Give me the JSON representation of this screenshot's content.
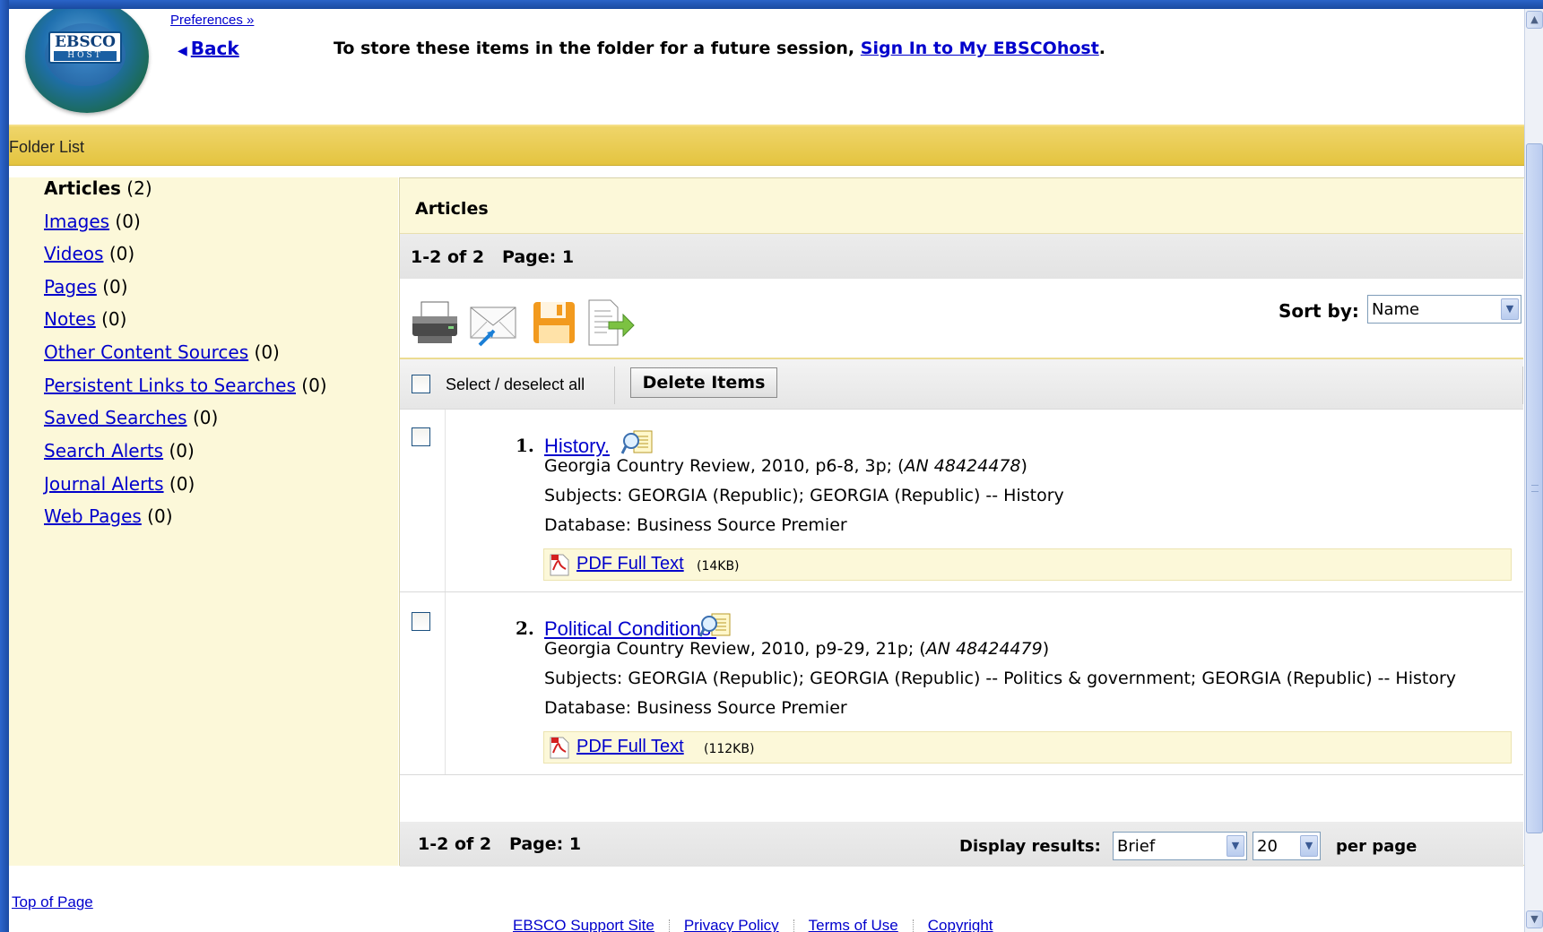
{
  "header": {
    "logo_text_top": "EBSCO",
    "logo_text_bottom": "HOST",
    "preferences_link": "Preferences »",
    "back_link": "Back",
    "signin_message_prefix": "To store these items in the folder for a future session,",
    "signin_link": "Sign In to My EBSCOhost",
    "signin_message_suffix": "."
  },
  "folder_bar": {
    "title": "Folder List"
  },
  "sidebar": {
    "items": [
      {
        "label": "Articles",
        "count": "(2)",
        "active": true
      },
      {
        "label": "Images",
        "count": "(0)"
      },
      {
        "label": "Videos",
        "count": "(0)"
      },
      {
        "label": "Pages",
        "count": "(0)"
      },
      {
        "label": "Notes",
        "count": "(0)"
      },
      {
        "label": "Other Content Sources",
        "count": "(0)"
      },
      {
        "label": "Persistent Links to Searches",
        "count": "(0)"
      },
      {
        "label": "Saved Searches",
        "count": "(0)"
      },
      {
        "label": "Search Alerts",
        "count": "(0)"
      },
      {
        "label": "Journal Alerts",
        "count": "(0)"
      },
      {
        "label": "Web Pages",
        "count": "(0)"
      }
    ]
  },
  "main": {
    "title": "Articles",
    "pager_text": "1-2 of 2   Page: 1",
    "toolbar": {
      "icons": [
        "print-icon",
        "email-icon",
        "save-icon",
        "export-icon"
      ],
      "sort_label": "Sort by:",
      "sort_value": "Name"
    },
    "select_all_label": "Select / deselect all",
    "delete_button": "Delete Items",
    "results": [
      {
        "number": "1.",
        "title": "History.",
        "source_prefix": "Georgia Country Review, 2010, p6-8, 3p; (",
        "accession": "AN 48424478",
        "source_suffix": ")",
        "subjects": "Subjects: GEORGIA (Republic); GEORGIA (Republic) -- History",
        "database": "Database: Business Source Premier",
        "pdf_link": "PDF Full Text",
        "pdf_size": "(14KB)"
      },
      {
        "number": "2.",
        "title": "Political Conditions.",
        "source_prefix": "Georgia Country Review, 2010, p9-29, 21p; (",
        "accession": "AN 48424479",
        "source_suffix": ")",
        "subjects": "Subjects: GEORGIA (Republic); GEORGIA (Republic) -- Politics & government; GEORGIA (Republic) -- History",
        "database": "Database: Business Source Premier",
        "pdf_link": "PDF Full Text",
        "pdf_size": "(112KB)"
      }
    ],
    "bottom_pager": {
      "count_text": "1-2 of 2   Page: 1",
      "display_label": "Display results:",
      "display_value": "Brief",
      "per_page_value": "20",
      "per_page_label": "per page"
    }
  },
  "footer": {
    "top_of_page": "Top of Page",
    "links": [
      "EBSCO Support Site",
      "Privacy Policy",
      "Terms of Use",
      "Copyright"
    ]
  }
}
